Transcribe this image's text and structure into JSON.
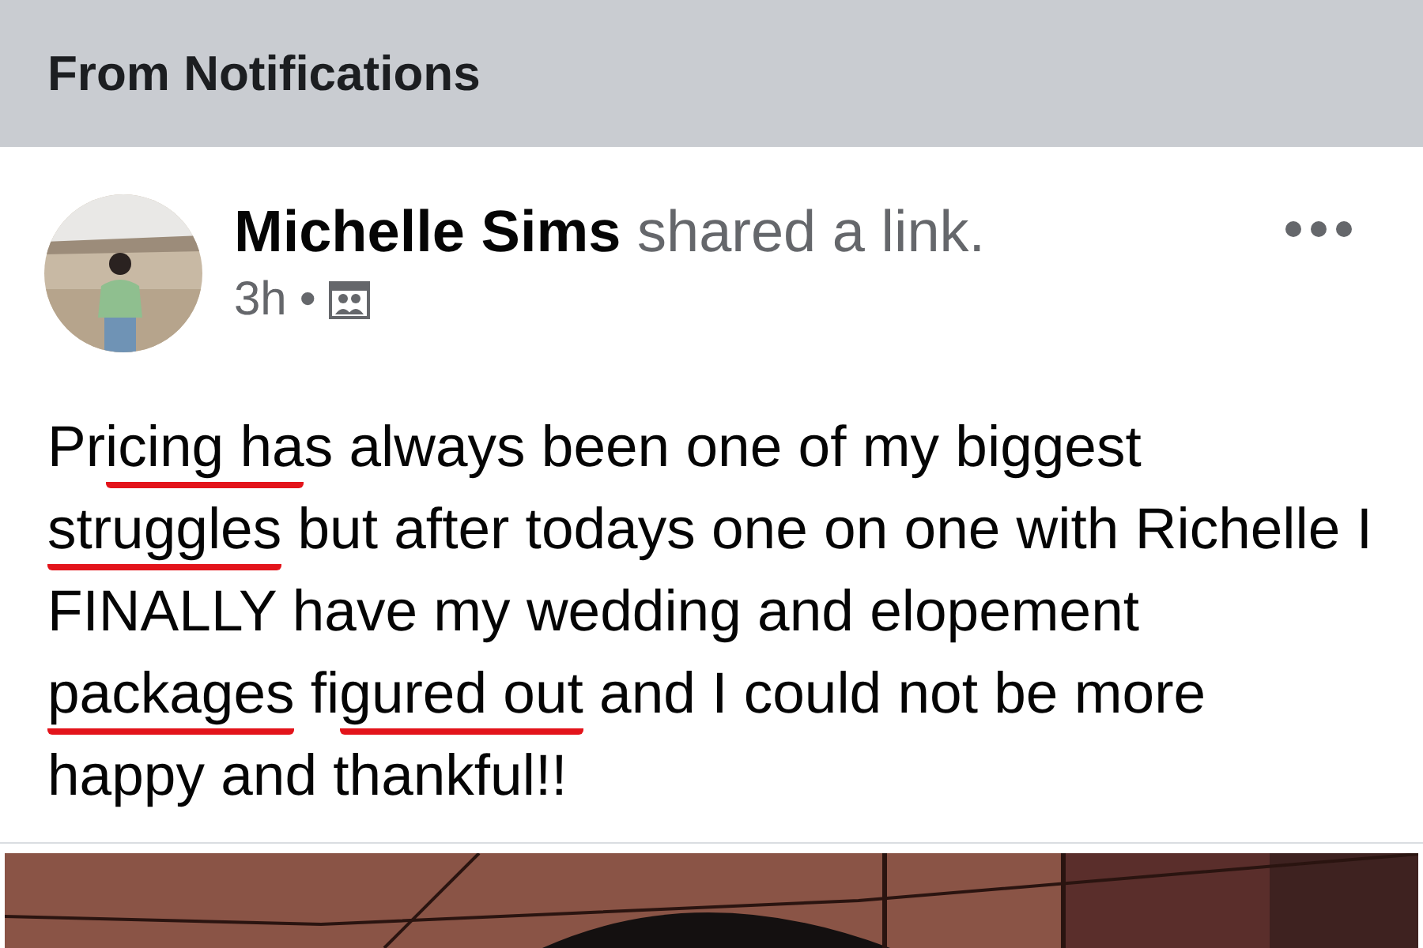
{
  "header": {
    "title": "From Notifications"
  },
  "post": {
    "author": "Michelle Sims",
    "action": "shared a link.",
    "time": "3h",
    "separator": "•",
    "text": [
      {
        "text": "Pr",
        "underlined": false
      },
      {
        "text": "icing ha",
        "underlined": true
      },
      {
        "text": "s always been one of my biggest ",
        "underlined": false
      },
      {
        "text": "struggles",
        "underlined": true
      },
      {
        "text": " but after todays one on one with Richelle I FINALLY have my wedding and elopement ",
        "underlined": false
      },
      {
        "text": "packages",
        "underlined": true
      },
      {
        "text": " fi",
        "underlined": false
      },
      {
        "text": "gured out",
        "underlined": true
      },
      {
        "text": " and I could not be more happy and thankful!!",
        "underlined": false
      }
    ]
  }
}
